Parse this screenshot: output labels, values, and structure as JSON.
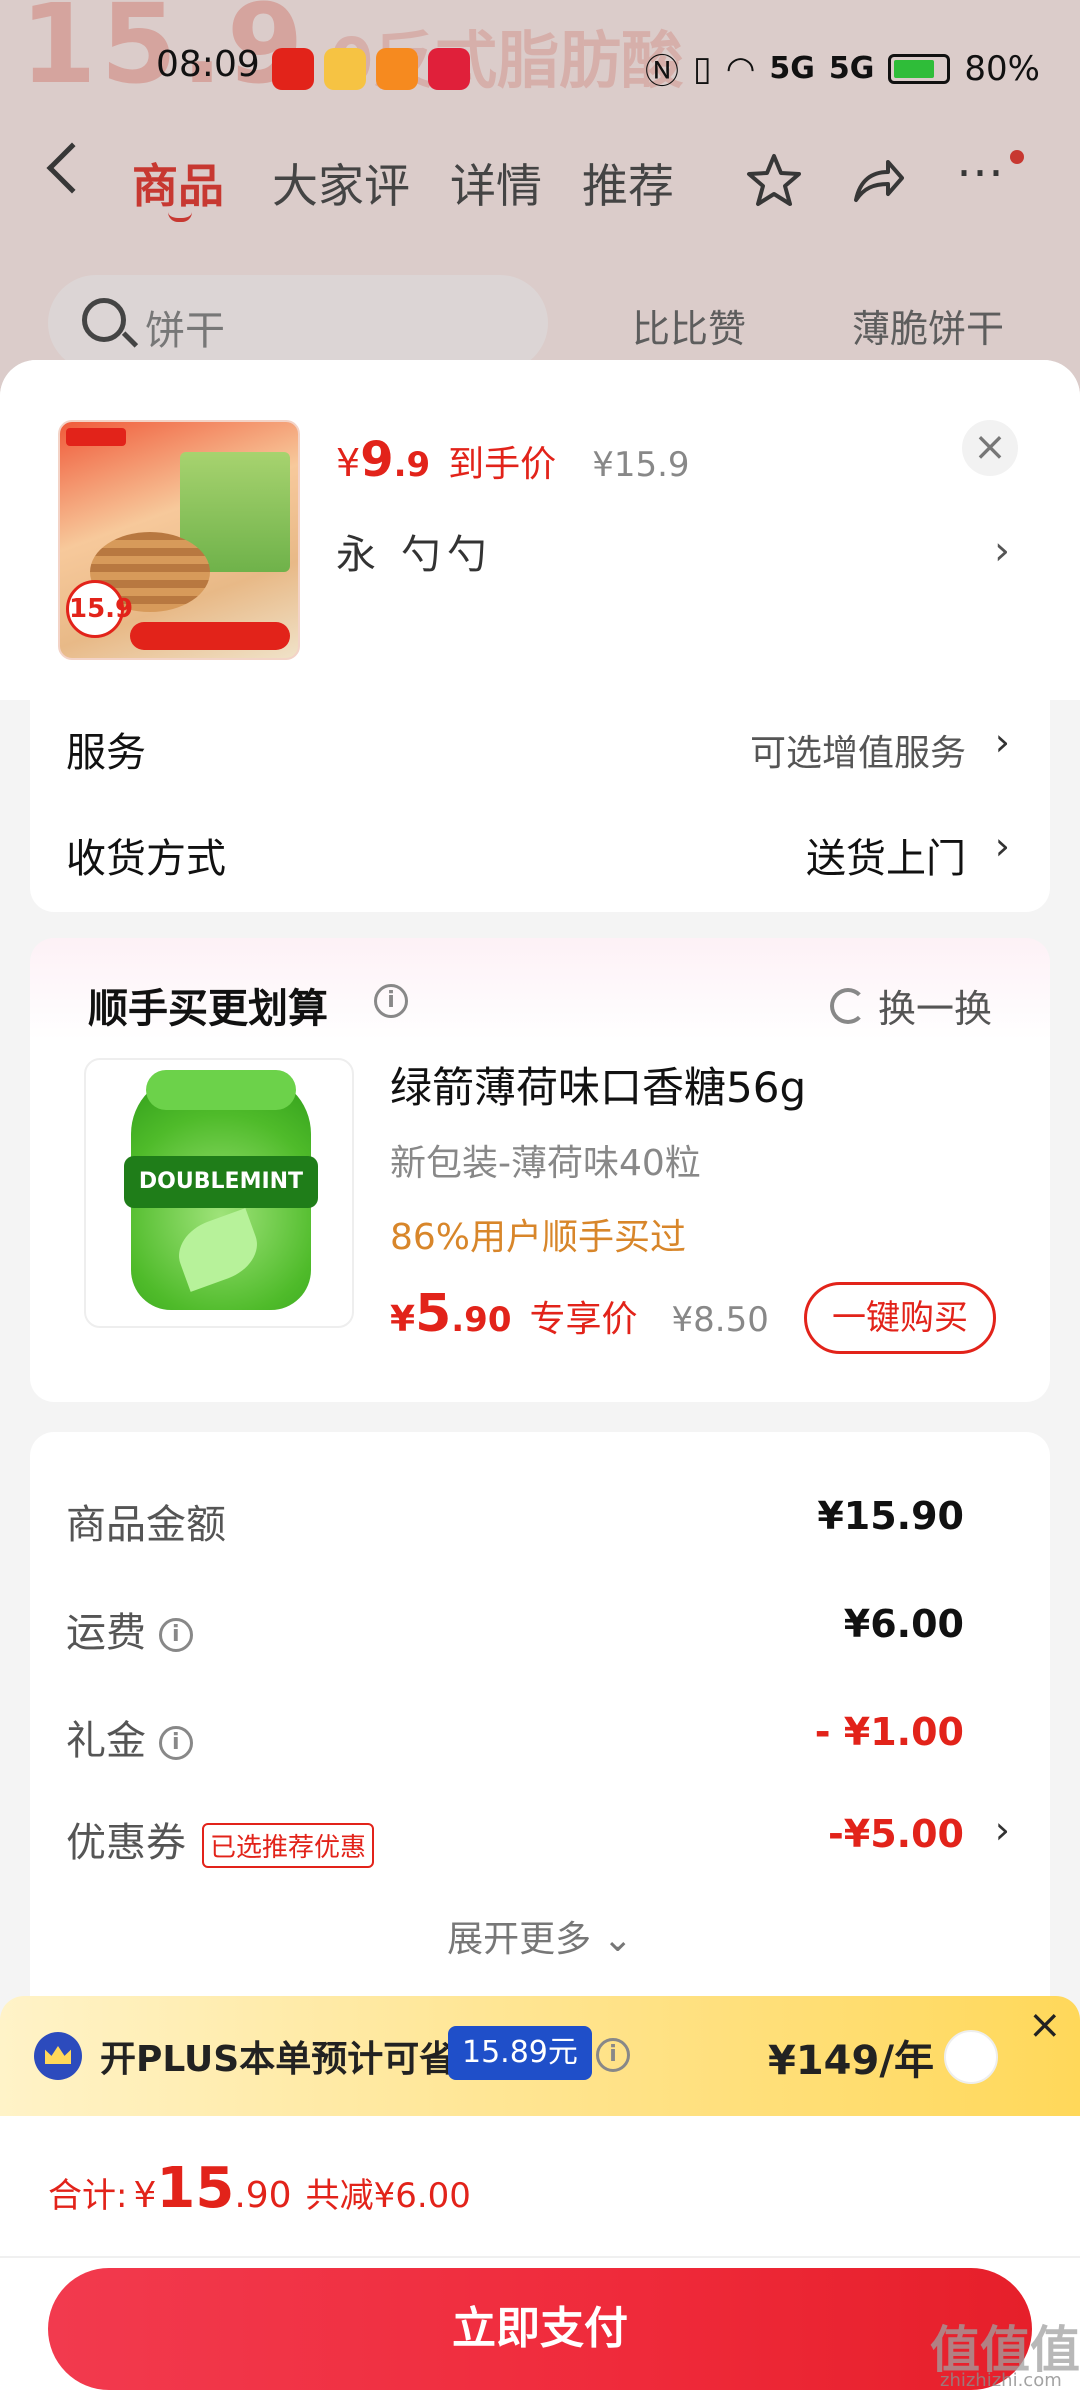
{
  "status_bar": {
    "time": "08:09",
    "signal1": "5G",
    "signal2": "5G",
    "battery": "80%",
    "battery_level": 0.8
  },
  "background_page": {
    "banner_price": "15.9",
    "banner_text": "0反式脂肪酸",
    "tabs": [
      "商品",
      "大家评",
      "详情",
      "推荐"
    ],
    "active_tab": "商品",
    "search_placeholder": "饼干",
    "chips": [
      "比比赞",
      "薄脆饼干"
    ],
    "accent": "#e2231a"
  },
  "sheet": {
    "close_label": "×",
    "product": {
      "price_yen": "¥",
      "price_int": "9",
      "price_dec": ".9",
      "price_tag": "到手价",
      "original_price": "¥15.9",
      "spec": "永 勺勺",
      "thumb_price": "15.9"
    },
    "service": {
      "label": "服务",
      "value": "可选增值服务"
    },
    "delivery": {
      "label": "收货方式",
      "value": "送货上门"
    },
    "addon": {
      "title": "顺手买更划算",
      "refresh_label": "换一换",
      "item_name": "绿箭薄荷味口香糖56g",
      "item_variant": "新包装-薄荷味40粒",
      "item_social": "86%用户顺手买过",
      "price_yen": "¥",
      "price_int": "5",
      "price_dec": ".90",
      "price_tag": "专享价",
      "original_price": "¥8.50",
      "buy_label": "一键购买",
      "jar_label": "DOUBLEMINT"
    },
    "summary": {
      "goods_label": "商品金额",
      "goods_value": "¥15.90",
      "shipping_label": "运费",
      "shipping_value": "¥6.00",
      "gift_label": "礼金",
      "gift_value": "- ¥1.00",
      "coupon_label": "优惠券",
      "coupon_badge": "已选推荐优惠",
      "coupon_value": "-¥5.00",
      "expand_label": "展开更多"
    },
    "plus": {
      "text": "开PLUS本单预计可省",
      "amount": "15.89元",
      "price": "¥149/年"
    },
    "footer": {
      "total_label": "合计:",
      "total_yen": "¥",
      "total_int": "15",
      "total_dec": ".90",
      "discount": "共减¥6.00",
      "pay_label": "立即支付"
    }
  },
  "watermark": {
    "main": "值值值",
    "sub": "zhizhizhi.com"
  }
}
